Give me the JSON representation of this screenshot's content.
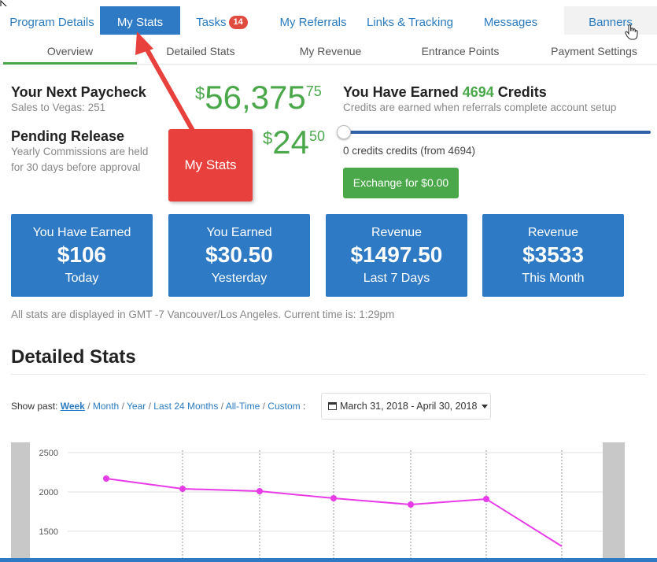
{
  "top_tabs": [
    {
      "label": "Program Details"
    },
    {
      "label": "My Stats"
    },
    {
      "label": "Tasks",
      "badge": "14"
    },
    {
      "label": "My Referrals"
    },
    {
      "label": "Links & Tracking"
    },
    {
      "label": "Messages"
    },
    {
      "label": "Banners"
    }
  ],
  "sub_tabs": [
    {
      "label": "Overview"
    },
    {
      "label": "Detailed Stats"
    },
    {
      "label": "My Revenue"
    },
    {
      "label": "Entrance Points"
    },
    {
      "label": "Payment Settings"
    }
  ],
  "paycheck": {
    "title": "Your Next Paycheck",
    "subtitle": "Sales to Vegas: 251",
    "currency": "$",
    "amount": "56,375",
    "cents": "75"
  },
  "pending": {
    "title": "Pending Release",
    "note_line1": "Yearly Commissions are held",
    "note_line2": "for 30 days before approval",
    "currency": "$",
    "amount": "24",
    "cents": "50"
  },
  "credits": {
    "title_prefix": "You Have Earned ",
    "count": "4694",
    "title_suffix": " Credits",
    "subtitle": "Credits are earned when referrals complete account setup",
    "slider_text": "0 credits credits (from 4694)",
    "slider_fraction": 0,
    "exchange_label": "Exchange for $0.00"
  },
  "callout": {
    "label": "My Stats"
  },
  "stat_cards": [
    {
      "top": "You Have Earned",
      "value": "$106",
      "bottom": "Today"
    },
    {
      "top": "You Earned",
      "value": "$30.50",
      "bottom": "Yesterday"
    },
    {
      "top": "Revenue",
      "value": "$1497.50",
      "bottom": "Last 7 Days"
    },
    {
      "top": "Revenue",
      "value": "$3533",
      "bottom": "This Month"
    }
  ],
  "timezone_note": "All stats are displayed in GMT -7 Vancouver/Los Angeles. Current time is: 1:29pm",
  "detailed": {
    "title": "Detailed Stats",
    "show_past_label": "Show past:",
    "ranges": [
      "Week",
      "Month",
      "Year",
      "Last 24 Months",
      "All-Time",
      "Custom"
    ],
    "active_range": "Week",
    "range_suffix": ":",
    "date_range": "March 31, 2018 - April 30, 2018"
  },
  "colors": {
    "accent": "#2f7ac4",
    "green": "#4aa84a",
    "badge": "#e04a3f",
    "line": "#e83be8"
  },
  "chart_data": {
    "type": "line",
    "y_ticks": [
      "2500",
      "2000",
      "1500"
    ],
    "ylim_visible": [
      1300,
      2500
    ],
    "x": [
      1,
      2,
      3,
      4,
      5,
      6,
      7
    ],
    "values": [
      2170,
      2040,
      2010,
      1920,
      1840,
      1910,
      1310
    ],
    "grid": true
  }
}
